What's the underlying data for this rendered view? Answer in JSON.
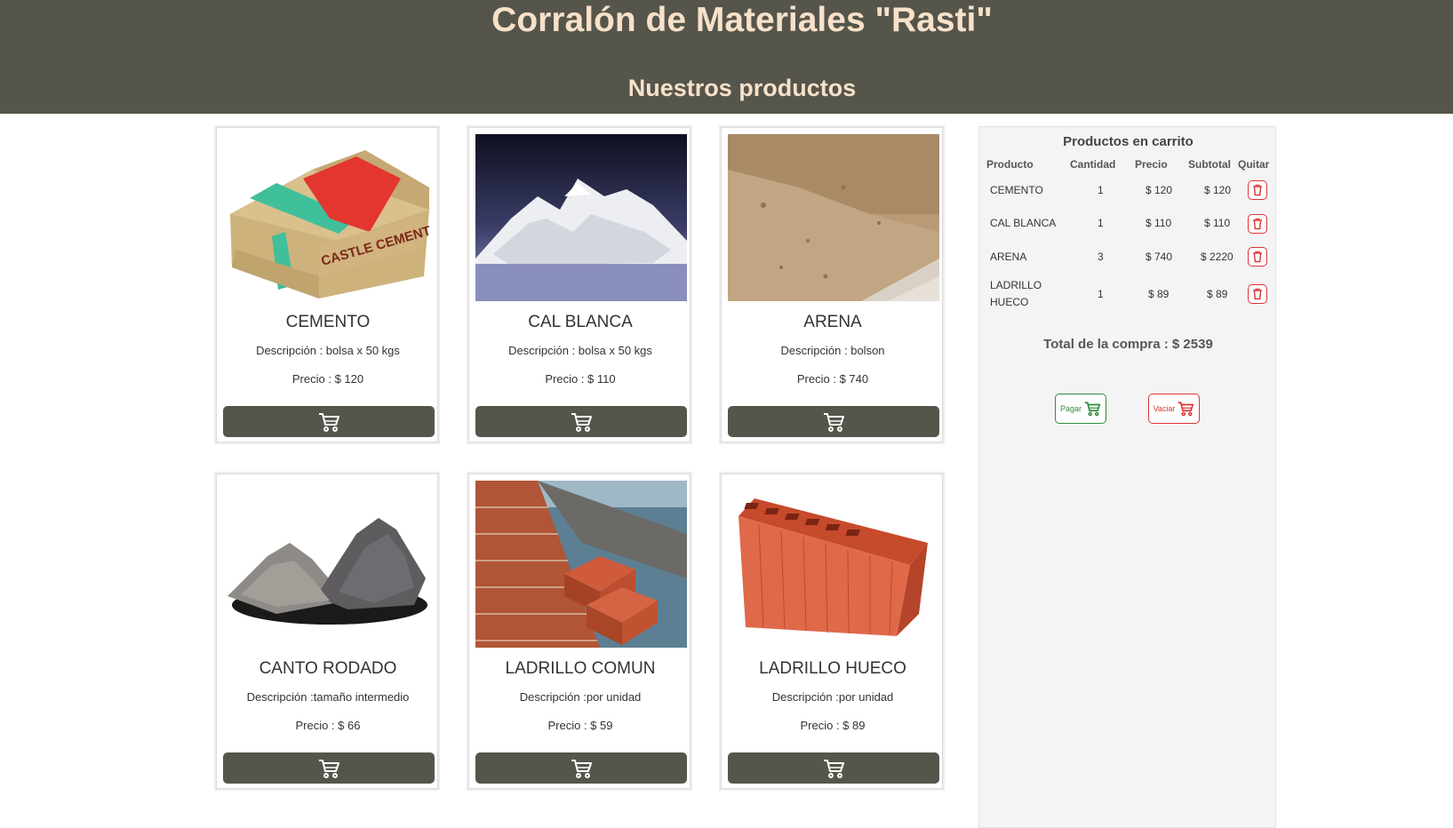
{
  "header": {
    "title": "Corralón de Materiales \"Rasti\"",
    "subtitle": "Nuestros productos"
  },
  "colors": {
    "header_bg": "#55554b",
    "header_text": "#f7e1c9",
    "button_bg": "#55554b",
    "pay_green": "#2e8b3a",
    "danger_red": "#dd3333"
  },
  "products": [
    {
      "name": "CEMENTO",
      "description": "Descripción : bolsa x 50 kgs",
      "price": "Precio : $ 120",
      "image_icon": "cement-bag-image",
      "image_text": "CASTLE CEMENT"
    },
    {
      "name": "CAL BLANCA",
      "description": "Descripción : bolsa x 50 kgs",
      "price": "Precio : $ 110",
      "image_icon": "white-lime-powder-image"
    },
    {
      "name": "ARENA",
      "description": "Descripción : bolson",
      "price": "Precio : $ 740",
      "image_icon": "sand-pile-image"
    },
    {
      "name": "CANTO RODADO",
      "description": "Descripción :tamaño intermedio",
      "price": "Precio : $ 66",
      "image_icon": "gravel-piles-image"
    },
    {
      "name": "LADRILLO COMUN",
      "description": "Descripción :por unidad",
      "price": "Precio : $ 59",
      "image_icon": "brick-wall-image"
    },
    {
      "name": "LADRILLO HUECO",
      "description": "Descripción :por unidad",
      "price": "Precio : $ 89",
      "image_icon": "hollow-brick-image"
    }
  ],
  "cart": {
    "title": "Productos en carrito",
    "columns": [
      "Producto",
      "Cantidad",
      "Precio",
      "Subtotal",
      "Quitar"
    ],
    "rows": [
      {
        "product": "CEMENTO",
        "quantity": "1",
        "price": "$ 120",
        "subtotal": "$ 120"
      },
      {
        "product": "CAL BLANCA",
        "quantity": "1",
        "price": "$ 110",
        "subtotal": "$ 110"
      },
      {
        "product": "ARENA",
        "quantity": "3",
        "price": "$ 740",
        "subtotal": "$ 2220"
      },
      {
        "product": "LADRILLO HUECO",
        "product_line1": "LADRILLO",
        "product_line2": "HUECO",
        "quantity": "1",
        "price": "$ 89",
        "subtotal": "$ 89"
      }
    ],
    "total": "Total de la compra : $ 2539",
    "pay_label": "Pagar",
    "empty_label": "Vaciar"
  }
}
